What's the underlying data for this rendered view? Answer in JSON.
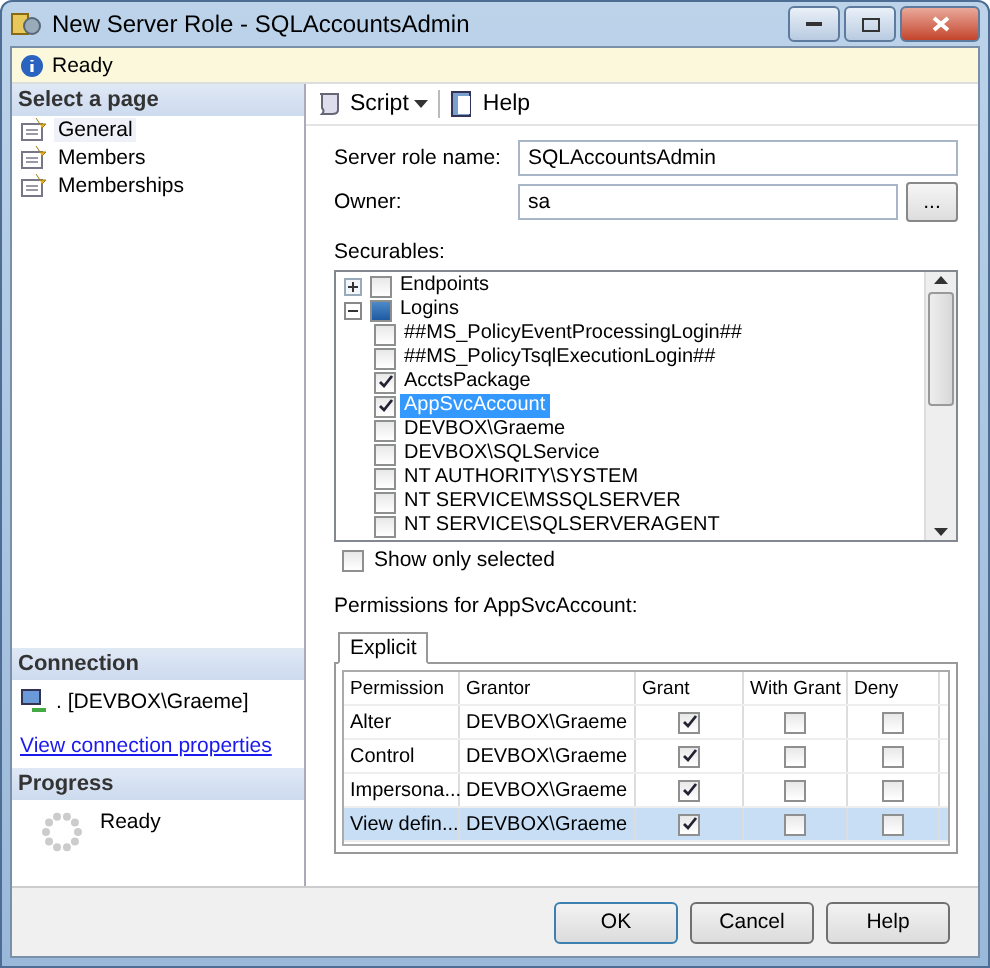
{
  "window": {
    "title": "New Server Role - SQLAccountsAdmin"
  },
  "status": {
    "text": "Ready"
  },
  "sidebar": {
    "heading": "Select a page",
    "items": [
      {
        "label": "General",
        "selected": true
      },
      {
        "label": "Members",
        "selected": false
      },
      {
        "label": "Memberships",
        "selected": false
      }
    ]
  },
  "connection": {
    "heading": "Connection",
    "server": ". [DEVBOX\\Graeme]",
    "link": "View connection properties"
  },
  "progress": {
    "heading": "Progress",
    "text": "Ready"
  },
  "toolbar": {
    "script": "Script",
    "help": "Help"
  },
  "form": {
    "name_label": "Server role name:",
    "name_value": "SQLAccountsAdmin",
    "owner_label": "Owner:",
    "owner_value": "sa",
    "browse": "..."
  },
  "securables": {
    "label": "Securables:",
    "items": [
      {
        "label": "Endpoints",
        "checked": false,
        "partial": false,
        "expanded": false,
        "selected": false
      },
      {
        "label": "Logins",
        "checked": false,
        "partial": true,
        "expanded": true,
        "selected": false,
        "children": [
          {
            "label": "##MS_PolicyEventProcessingLogin##",
            "checked": false,
            "selected": false
          },
          {
            "label": "##MS_PolicyTsqlExecutionLogin##",
            "checked": false,
            "selected": false
          },
          {
            "label": "AcctsPackage",
            "checked": true,
            "selected": false
          },
          {
            "label": "AppSvcAccount",
            "checked": true,
            "selected": true
          },
          {
            "label": "DEVBOX\\Graeme",
            "checked": false,
            "selected": false
          },
          {
            "label": "DEVBOX\\SQLService",
            "checked": false,
            "selected": false
          },
          {
            "label": "NT AUTHORITY\\SYSTEM",
            "checked": false,
            "selected": false
          },
          {
            "label": "NT SERVICE\\MSSQLSERVER",
            "checked": false,
            "selected": false
          },
          {
            "label": "NT SERVICE\\SQLSERVERAGENT",
            "checked": false,
            "selected": false
          }
        ]
      }
    ],
    "show_only_selected": {
      "label": "Show only selected",
      "checked": false
    }
  },
  "permissions": {
    "label": "Permissions for AppSvcAccount:",
    "tabs": [
      {
        "label": "Explicit",
        "selected": true
      }
    ],
    "columns": [
      "Permission",
      "Grantor",
      "Grant",
      "With Grant",
      "Deny"
    ],
    "rows": [
      {
        "permission": "Alter",
        "grantor": "DEVBOX\\Graeme",
        "grant": true,
        "with_grant": false,
        "deny": false,
        "selected": false
      },
      {
        "permission": "Control",
        "grantor": "DEVBOX\\Graeme",
        "grant": true,
        "with_grant": false,
        "deny": false,
        "selected": false
      },
      {
        "permission": "Impersona...",
        "grantor": "DEVBOX\\Graeme",
        "grant": true,
        "with_grant": false,
        "deny": false,
        "selected": false
      },
      {
        "permission": "View defin...",
        "grantor": "DEVBOX\\Graeme",
        "grant": true,
        "with_grant": false,
        "deny": false,
        "selected": true
      }
    ]
  },
  "buttons": [
    "OK",
    "Cancel",
    "Help"
  ]
}
